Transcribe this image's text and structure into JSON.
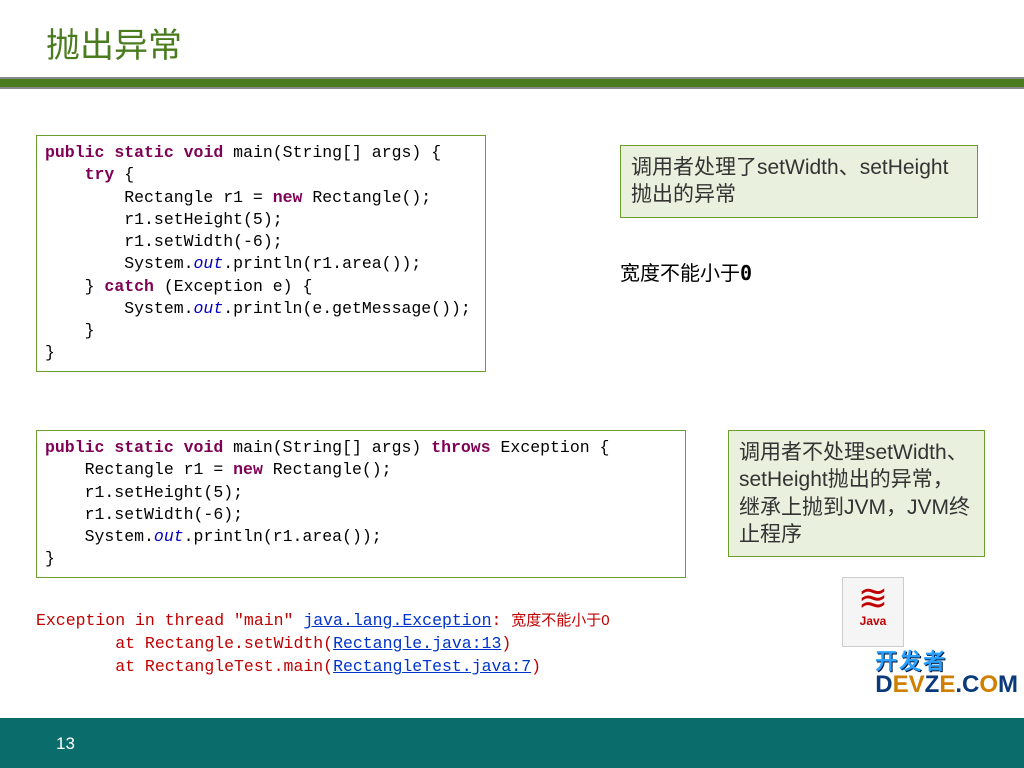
{
  "title": "抛出异常",
  "page_number": "13",
  "code_blocks": {
    "block1": {
      "l1a": "public",
      "l1b": "static",
      "l1c": "void",
      "l1d": " main(String[] args) {",
      "l2a": "try",
      "l2b": " {",
      "l3a": "        Rectangle r1 = ",
      "l3b": "new",
      "l3c": " Rectangle();",
      "l4": "        r1.setHeight(5);",
      "l5": "        r1.setWidth(-6);",
      "l6a": "        System.",
      "l6b": "out",
      "l6c": ".println(r1.area());",
      "l7a": "    } ",
      "l7b": "catch",
      "l7c": " (Exception e) {",
      "l8a": "        System.",
      "l8b": "out",
      "l8c": ".println(e.getMessage());",
      "l9": "    }",
      "l10": "}"
    },
    "block2": {
      "l1a": "public",
      "l1b": "static",
      "l1c": "void",
      "l1d": " main(String[] args) ",
      "l1e": "throws",
      "l1f": " Exception {",
      "l2a": "    Rectangle r1 = ",
      "l2b": "new",
      "l2c": " Rectangle();",
      "l3": "    r1.setHeight(5);",
      "l4": "    r1.setWidth(-6);",
      "l5a": "    System.",
      "l5b": "out",
      "l5c": ".println(r1.area());",
      "l6": "}"
    }
  },
  "annotations": {
    "a1": "调用者处理了setWidth、setHeight抛出的异常",
    "a2": "调用者不处理setWidth、setHeight抛出的异常，继承上抛到JVM，JVM终止程序"
  },
  "output": {
    "label_prefix": "宽度不能小于",
    "label_zero": "0"
  },
  "stacktrace": {
    "l1a": "Exception in thread \"main\" ",
    "l1b": "java.lang.Exception",
    "l1c": ": ",
    "l1d": "宽度不能小于0",
    "l2a": "        at Rectangle.setWidth(",
    "l2b": "Rectangle.java:13",
    "l2c": ")",
    "l3a": "        at RectangleTest.main(",
    "l3b": "RectangleTest.java:7",
    "l3c": ")"
  },
  "logo": {
    "java": "Java",
    "devze_cn": "开发者",
    "devze_en_1": "D",
    "devze_en_2": "EV",
    "devze_en_3": "Z",
    "devze_en_4": "E",
    "devze_en_5": ".C",
    "devze_en_6": "O",
    "devze_en_7": "M"
  }
}
